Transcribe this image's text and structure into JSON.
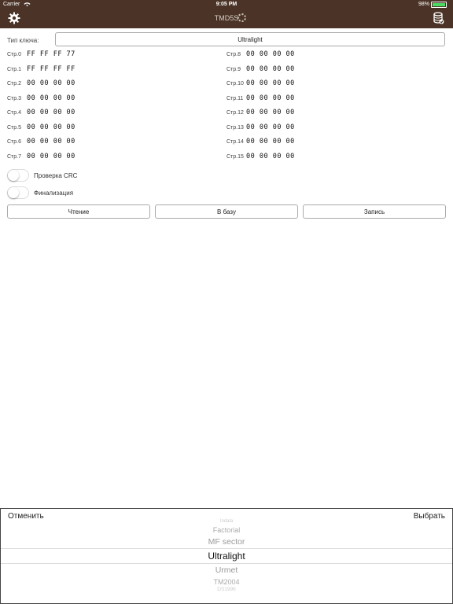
{
  "status": {
    "carrier": "Carrier",
    "time": "9:05 PM",
    "battery": "98%",
    "battery_level": 0.98
  },
  "nav": {
    "title": "TMD5S",
    "left_icon": "gear-icon",
    "right_icon": "database-icon"
  },
  "key_type": {
    "label": "Тип ключа:",
    "value": "Ultralight"
  },
  "pages_left": [
    {
      "label": "Стр.0",
      "value": "FF FF FF 77"
    },
    {
      "label": "Стр.1",
      "value": "FF FF FF FF"
    },
    {
      "label": "Стр.2",
      "value": "00 00 00 00"
    },
    {
      "label": "Стр.3",
      "value": "00 00 00 00"
    },
    {
      "label": "Стр.4",
      "value": "00 00 00 00"
    },
    {
      "label": "Стр.5",
      "value": "00 00 00 00"
    },
    {
      "label": "Стр.6",
      "value": "00 00 00 00"
    },
    {
      "label": "Стр.7",
      "value": "00 00 00 00"
    }
  ],
  "pages_right": [
    {
      "label": "Стр.8",
      "value": "00 00 00 00"
    },
    {
      "label": "Стр.9",
      "value": "00 00 00 00"
    },
    {
      "label": "Стр.10",
      "value": "00 00 00 00"
    },
    {
      "label": "Стр.11",
      "value": "00 00 00 00"
    },
    {
      "label": "Стр.12",
      "value": "00 00 00 00"
    },
    {
      "label": "Стр.13",
      "value": "00 00 00 00"
    },
    {
      "label": "Стр.14",
      "value": "00 00 00 00"
    },
    {
      "label": "Стр.15",
      "value": "00 00 00 00"
    }
  ],
  "toggles": [
    {
      "label": "Проверка CRC",
      "on": false
    },
    {
      "label": "Финализация",
      "on": false
    }
  ],
  "buttons": {
    "read": "Чтение",
    "to_db": "В базу",
    "write": "Запись"
  },
  "picker": {
    "cancel": "Отменить",
    "done": "Выбрать",
    "items": [
      "Indala",
      "Factorial",
      "MF sector",
      "Ultralight",
      "Urmet",
      "TM2004",
      "DS1996"
    ],
    "selected": "Ultralight"
  },
  "colors": {
    "nav_bg": "#4b3427",
    "battery": "#4cd964"
  }
}
